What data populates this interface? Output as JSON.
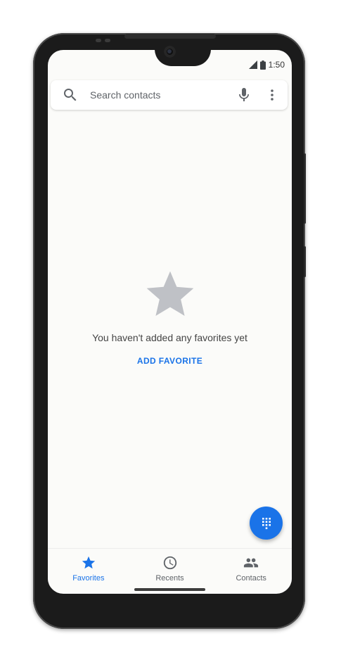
{
  "status_bar": {
    "time": "1:50"
  },
  "search": {
    "placeholder": "Search contacts"
  },
  "empty_state": {
    "message": "You haven't added any favorites yet",
    "action_label": "ADD FAVORITE"
  },
  "bottom_nav": {
    "items": [
      {
        "label": "Favorites",
        "icon": "star-icon",
        "active": true
      },
      {
        "label": "Recents",
        "icon": "clock-icon",
        "active": false
      },
      {
        "label": "Contacts",
        "icon": "people-icon",
        "active": false
      }
    ]
  },
  "colors": {
    "accent": "#1a73e8",
    "empty_star": "#bfc1c6",
    "background": "#fbfbf9"
  }
}
